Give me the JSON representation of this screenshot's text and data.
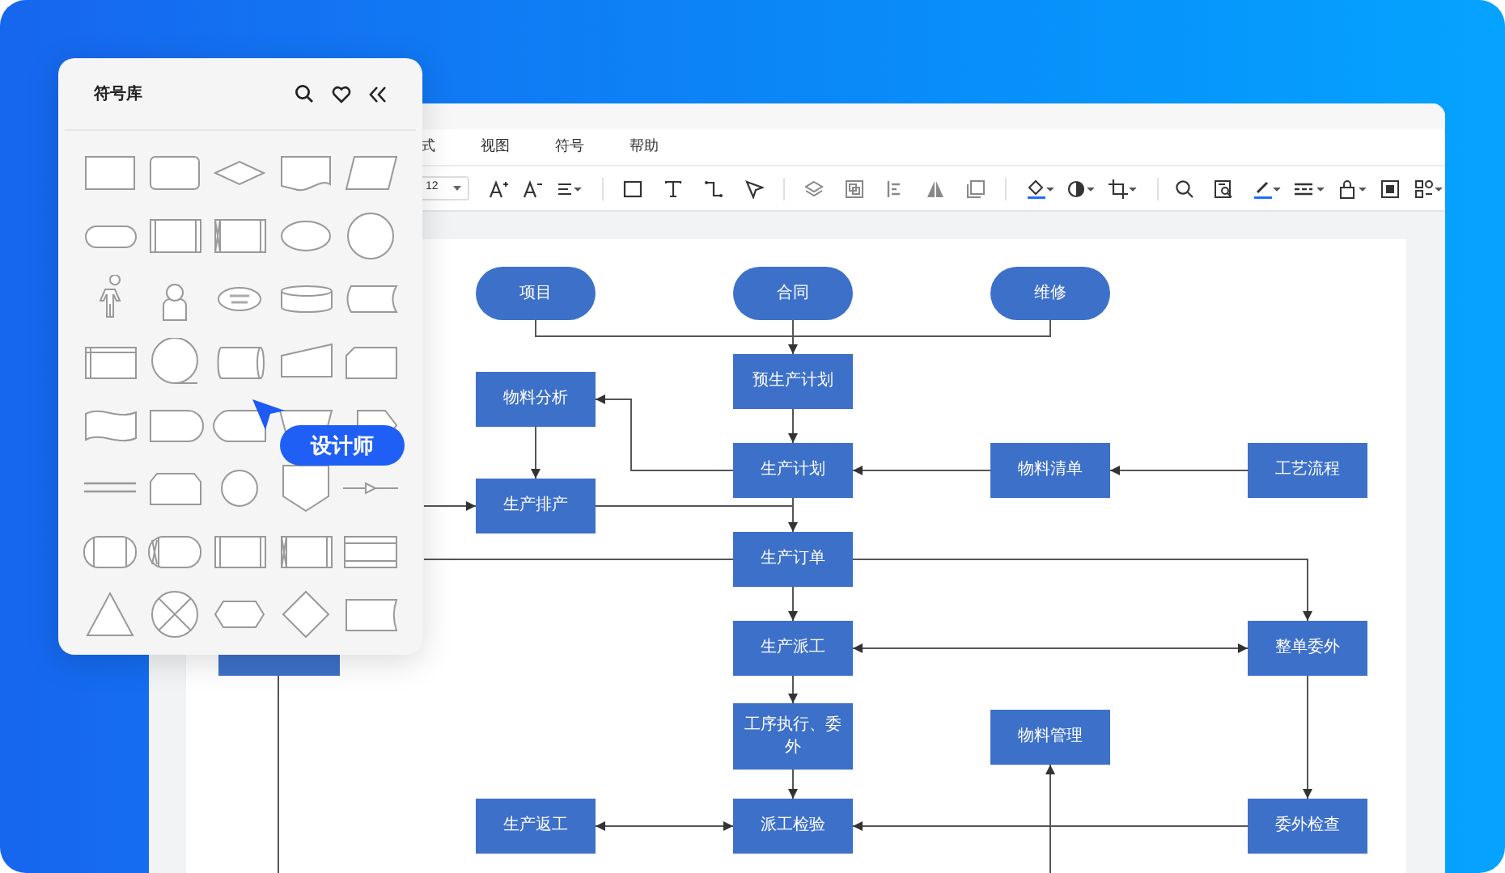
{
  "menu": [
    {
      "label": "式"
    },
    {
      "label": "视图"
    },
    {
      "label": "符号"
    },
    {
      "label": "帮助"
    }
  ],
  "toolbar": {
    "font_size": "12"
  },
  "symbol_library": {
    "title": "符号库"
  },
  "cursor_tag": {
    "label": "设计师"
  },
  "diagram": {
    "nodes": [
      {
        "label": "项目",
        "kind": "terminal"
      },
      {
        "label": "合同",
        "kind": "terminal"
      },
      {
        "label": "维修",
        "kind": "terminal"
      },
      {
        "label": "预生产计划",
        "kind": "process"
      },
      {
        "label": "物料分析",
        "kind": "process"
      },
      {
        "label": "生产计划",
        "kind": "process"
      },
      {
        "label": "物料清单",
        "kind": "process"
      },
      {
        "label": "工艺流程",
        "kind": "process"
      },
      {
        "label": "生产排产",
        "kind": "process"
      },
      {
        "label": "生产订单",
        "kind": "process"
      },
      {
        "label": "生产派工",
        "kind": "process"
      },
      {
        "label": "整单委外",
        "kind": "process"
      },
      {
        "label": "工序执行、委外",
        "kind": "process"
      },
      {
        "label": "物料管理",
        "kind": "process"
      },
      {
        "label": "生产返工",
        "kind": "process"
      },
      {
        "label": "派工检验",
        "kind": "process"
      },
      {
        "label": "委外检查",
        "kind": "process"
      }
    ]
  }
}
